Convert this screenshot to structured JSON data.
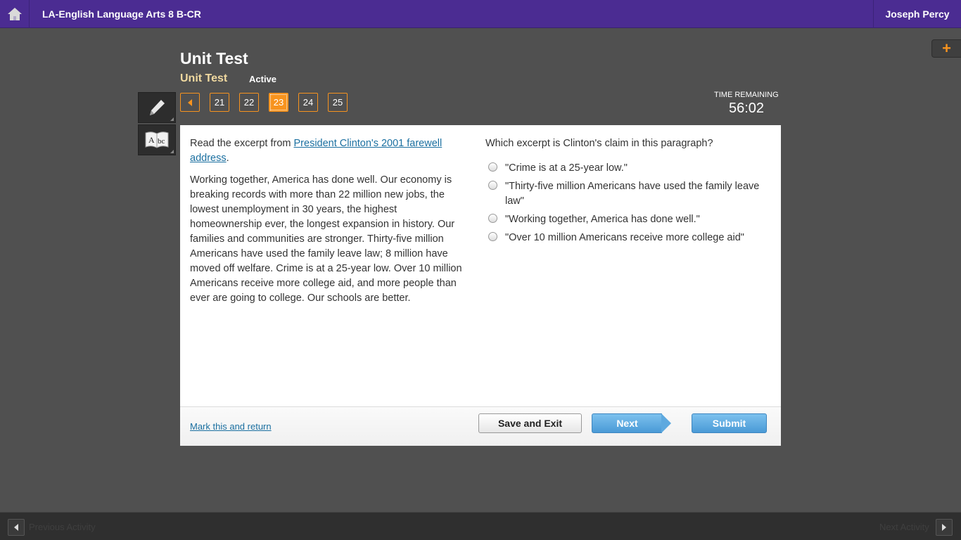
{
  "topbar": {
    "home_icon": "home-icon",
    "course_title": "LA-English Language Arts 8 B-CR",
    "user_name": "Joseph Percy"
  },
  "header": {
    "title": "Unit Test",
    "subtitle": "Unit Test",
    "status": "Active"
  },
  "tools": [
    "pencil-icon",
    "dictionary-icon"
  ],
  "pager": {
    "pages": [
      "21",
      "22",
      "23",
      "24",
      "25"
    ],
    "current": "23"
  },
  "timer": {
    "label": "TIME REMAINING",
    "value": "56:02"
  },
  "passage": {
    "intro": "Read the excerpt from ",
    "link": "President Clinton's 2001 farewell address",
    "intro_end": ".",
    "body": "Working together, America has done well. Our economy is breaking records with more than 22 million new jobs, the lowest unemployment in 30 years, the highest homeownership ever, the longest expansion in history. Our families and communities are stronger. Thirty-five million Americans have used the family leave law; 8 million have moved off welfare. Crime is at a 25-year low. Over 10 million Americans receive more college aid, and more people than ever are going to college. Our schools are better."
  },
  "question": {
    "prompt": "Which excerpt is Clinton's claim in this paragraph?",
    "choices": [
      "\"Crime is at a 25-year low.\"",
      "\"Thirty-five million Americans have used the family leave law\"",
      "\"Working together, America has done well.\"",
      "\"Over 10 million Americans receive more college aid\""
    ]
  },
  "footer": {
    "mark_link": "Mark this and return",
    "save_label": "Save and Exit",
    "next_label": "Next",
    "submit_label": "Submit"
  },
  "bottombar": {
    "prev_label": "Previous Activity",
    "next_label": "Next Activity"
  },
  "colors": {
    "topbar": "#4b2c92",
    "accent": "#f7931e",
    "button_blue": "#4a9ad6"
  }
}
